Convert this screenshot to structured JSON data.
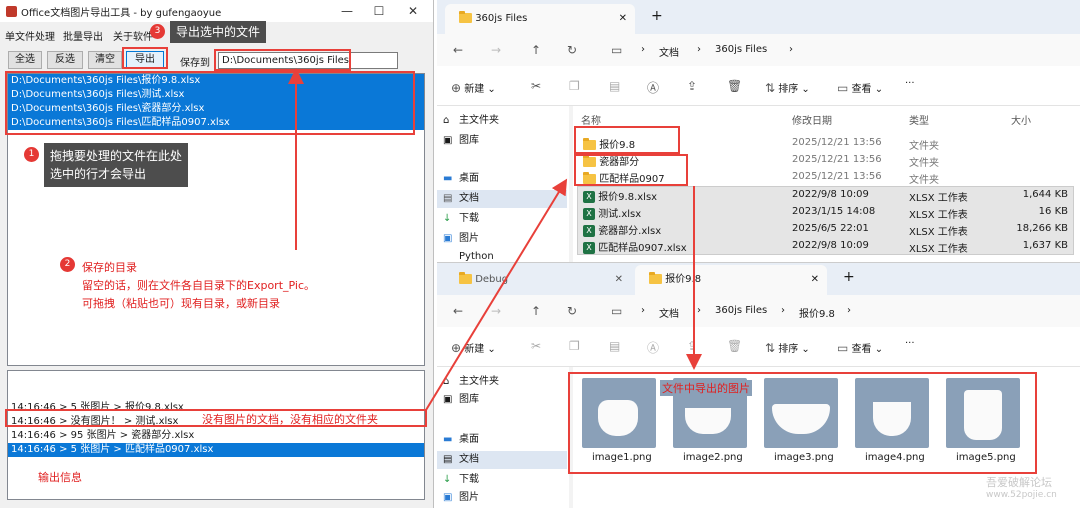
{
  "app": {
    "title": "Office文档图片导出工具 - by gufengaoyue",
    "menu": [
      "单文件处理",
      "批量导出",
      "关于软件"
    ],
    "buttons": {
      "select_all": "全选",
      "invert": "反选",
      "clear": "清空",
      "export": "导出"
    },
    "save_to_label": "保存到",
    "save_path": "D:\\Documents\\360js Files",
    "files": [
      "D:\\Documents\\360js Files\\报价9.8.xlsx",
      "D:\\Documents\\360js Files\\测试.xlsx",
      "D:\\Documents\\360js Files\\瓷器部分.xlsx",
      "D:\\Documents\\360js Files\\匹配样品0907.xlsx"
    ],
    "log": [
      {
        "time": "14:16:46",
        "text": "> 5   张图片 > 报价9.8.xlsx"
      },
      {
        "time": "14:16:46",
        "text": "> 没有图片！ > 测试.xlsx"
      },
      {
        "time": "14:16:46",
        "text": "> 95  张图片 > 瓷器部分.xlsx"
      },
      {
        "time": "14:16:46",
        "text": "> 5   张图片 > 匹配样品0907.xlsx"
      }
    ]
  },
  "annotations": {
    "n1": "1",
    "n2": "2",
    "n3": "3",
    "export_tip": "导出选中的文件",
    "drag_tip_l1": "拖拽要处理的文件在此处",
    "drag_tip_l2": "选中的行才会导出",
    "save_dir_title": "保存的目录",
    "save_dir_l1": "留空的话，则在文件各自目录下的Export_Pic。",
    "save_dir_l2": "可拖拽（粘贴也可）现有目录，或新目录",
    "no_image_note": "没有图片的文档，没有相应的文件夹",
    "output_info": "输出信息",
    "exported_images": "文件中导出的图片"
  },
  "explorer1": {
    "tab": "360js Files",
    "crumbs": [
      "文档",
      "360js Files"
    ],
    "cmd": {
      "new": "新建",
      "sort": "排序",
      "view": "查看"
    },
    "columns": {
      "name": "名称",
      "date": "修改日期",
      "type": "类型",
      "size": "大小"
    },
    "nav": [
      "主文件夹",
      "图库",
      "桌面",
      "文档",
      "下载",
      "图片",
      "Python"
    ],
    "rows": [
      {
        "name": "报价9.8",
        "date": "2025/12/21 13:56",
        "type": "文件夹",
        "size": "",
        "kind": "folder"
      },
      {
        "name": "瓷器部分",
        "date": "2025/12/21 13:56",
        "type": "文件夹",
        "size": "",
        "kind": "folder"
      },
      {
        "name": "匹配样品0907",
        "date": "2025/12/21 13:56",
        "type": "文件夹",
        "size": "",
        "kind": "folder"
      },
      {
        "name": "报价9.8.xlsx",
        "date": "2022/9/8 10:09",
        "type": "XLSX 工作表",
        "size": "1,644 KB",
        "kind": "xlsx"
      },
      {
        "name": "测试.xlsx",
        "date": "2023/1/15 14:08",
        "type": "XLSX 工作表",
        "size": "16 KB",
        "kind": "xlsx"
      },
      {
        "name": "瓷器部分.xlsx",
        "date": "2025/6/5 22:01",
        "type": "XLSX 工作表",
        "size": "18,266 KB",
        "kind": "xlsx"
      },
      {
        "name": "匹配样品0907.xlsx",
        "date": "2022/9/8 10:09",
        "type": "XLSX 工作表",
        "size": "1,637 KB",
        "kind": "xlsx"
      }
    ]
  },
  "explorer2": {
    "tabs": [
      "Debug",
      "报价9.8"
    ],
    "crumbs": [
      "文档",
      "360js Files",
      "报价9.8"
    ],
    "cmd": {
      "new": "新建",
      "sort": "排序",
      "view": "查看"
    },
    "nav": [
      "主文件夹",
      "图库",
      "桌面",
      "文档",
      "下载",
      "图片"
    ],
    "images": [
      "image1.png",
      "image2.png",
      "image3.png",
      "image4.png",
      "image5.png"
    ]
  },
  "watermark": {
    "l1": "吾爱破解论坛",
    "l2": "www.52pojie.cn"
  }
}
